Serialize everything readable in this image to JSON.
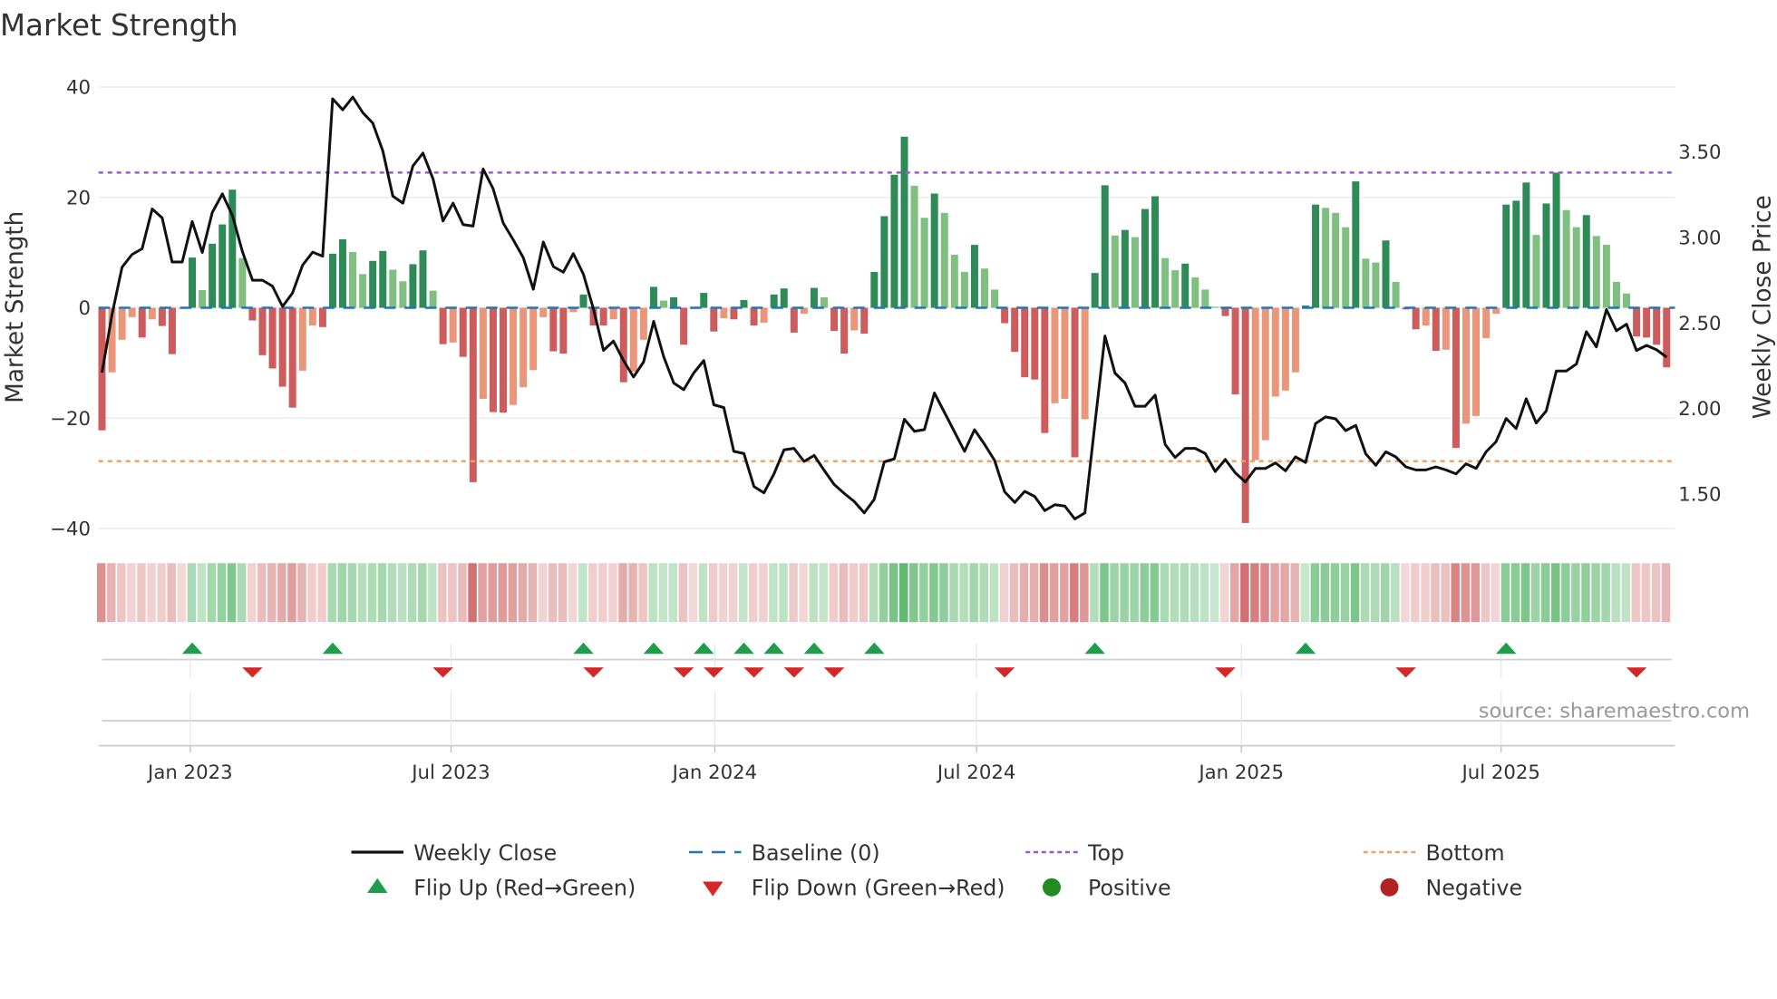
{
  "title": "Market Strength",
  "chart_data": {
    "type": "bar",
    "title": "Market Strength",
    "ylabel": "Market Strength",
    "y2label": "Weekly Close Price",
    "ylim": [
      -42,
      42
    ],
    "y2lim": [
      1.3,
      3.876
    ],
    "yticks": [
      "40",
      "20",
      "0",
      "−20",
      "−40"
    ],
    "ytick_values": [
      40,
      20,
      0,
      -20,
      -40
    ],
    "y2ticks": [
      "3.50",
      "3.00",
      "2.50",
      "2.00",
      "1.50"
    ],
    "y2tick_values": [
      3.5,
      3.0,
      2.5,
      2.0,
      1.5
    ],
    "xticks": [
      {
        "label": "Jan 2023",
        "week": 8.8
      },
      {
        "label": "Jul 2023",
        "week": 34.8
      },
      {
        "label": "Jan 2024",
        "week": 61.1
      },
      {
        "label": "Jul 2024",
        "week": 87.2
      },
      {
        "label": "Jan 2025",
        "week": 113.6
      },
      {
        "label": "Jul 2025",
        "week": 139.5
      }
    ],
    "top_level": 24.5,
    "bottom_level": -27.8,
    "baseline": 0,
    "strength": [
      -22.2,
      -11.7,
      -5.8,
      -1.7,
      -5.4,
      -2.1,
      -3.3,
      -8.4,
      -0.2,
      9.1,
      3.2,
      11.6,
      15.1,
      21.4,
      9.0,
      -2.3,
      -8.6,
      -11.0,
      -14.3,
      -18.1,
      -11.4,
      -3.2,
      -3.5,
      9.8,
      12.4,
      10.1,
      6.1,
      8.5,
      10.3,
      6.9,
      4.8,
      7.9,
      10.4,
      3.1,
      -6.6,
      -6.3,
      -8.9,
      -31.6,
      -16.5,
      -18.9,
      -19.0,
      -17.6,
      -14.4,
      -11.3,
      -1.7,
      -7.9,
      -8.3,
      -0.8,
      2.4,
      -3.2,
      -3.2,
      -2.1,
      -13.5,
      -11.6,
      -5.8,
      3.8,
      1.3,
      1.9,
      -6.7,
      -0.2,
      2.7,
      -4.3,
      -1.9,
      -2.1,
      1.4,
      -3.2,
      -2.7,
      2.4,
      3.5,
      -4.5,
      -1.1,
      3.6,
      1.9,
      -4.2,
      -8.3,
      -4.1,
      -4.7,
      6.5,
      16.6,
      24.1,
      31.0,
      22.1,
      16.3,
      20.7,
      17.2,
      9.6,
      6.5,
      11.4,
      7.1,
      3.3,
      -2.8,
      -8.0,
      -12.6,
      -13.0,
      -22.7,
      -17.3,
      -16.5,
      -27.1,
      -20.2,
      6.3,
      22.2,
      13.1,
      14.1,
      12.8,
      17.9,
      20.2,
      9.0,
      6.8,
      8.0,
      5.5,
      3.3,
      0.2,
      -1.5,
      -15.7,
      -39.0,
      -27.6,
      -24.0,
      -16.1,
      -15.0,
      -11.7,
      0.4,
      18.7,
      18.1,
      17.2,
      14.6,
      22.9,
      8.9,
      8.2,
      12.2,
      4.7,
      -0.3,
      -3.9,
      -3.2,
      -7.8,
      -7.6,
      -25.4,
      -21.0,
      -19.6,
      -5.5,
      -1.1,
      18.7,
      19.4,
      22.7,
      13.2,
      18.9,
      24.5,
      17.7,
      14.6,
      16.8,
      13.0,
      11.4,
      4.7,
      2.6,
      -5.2,
      -5.4,
      -6.7,
      -10.8
    ],
    "weekly_close": [
      2.21,
      2.548,
      2.826,
      2.9,
      2.934,
      3.166,
      3.114,
      2.856,
      2.856,
      3.093,
      2.912,
      3.146,
      3.254,
      3.128,
      2.917,
      2.75,
      2.75,
      2.715,
      2.596,
      2.675,
      2.838,
      2.914,
      2.89,
      3.81,
      3.746,
      3.82,
      3.729,
      3.668,
      3.505,
      3.242,
      3.2,
      3.417,
      3.493,
      3.342,
      3.096,
      3.2,
      3.075,
      3.066,
      3.4,
      3.285,
      3.084,
      2.987,
      2.882,
      2.697,
      2.973,
      2.829,
      2.797,
      2.905,
      2.785,
      2.583,
      2.34,
      2.394,
      2.28,
      2.184,
      2.272,
      2.509,
      2.303,
      2.149,
      2.11,
      2.207,
      2.28,
      2.022,
      2.005,
      1.75,
      1.737,
      1.544,
      1.507,
      1.617,
      1.758,
      1.767,
      1.691,
      1.726,
      1.639,
      1.556,
      1.504,
      1.456,
      1.39,
      1.469,
      1.688,
      1.705,
      1.937,
      1.867,
      1.877,
      2.091,
      1.977,
      1.863,
      1.75,
      1.876,
      1.79,
      1.697,
      1.513,
      1.451,
      1.516,
      1.486,
      1.403,
      1.438,
      1.43,
      1.354,
      1.39,
      1.908,
      2.424,
      2.207,
      2.149,
      2.013,
      2.013,
      2.078,
      1.79,
      1.714,
      1.767,
      1.767,
      1.737,
      1.632,
      1.702,
      1.624,
      1.571,
      1.65,
      1.65,
      1.682,
      1.636,
      1.717,
      1.685,
      1.912,
      1.951,
      1.94,
      1.871,
      1.901,
      1.735,
      1.668,
      1.747,
      1.717,
      1.659,
      1.641,
      1.641,
      1.659,
      1.641,
      1.618,
      1.677,
      1.65,
      1.747,
      1.806,
      1.942,
      1.883,
      2.057,
      1.915,
      1.986,
      2.219,
      2.219,
      2.26,
      2.449,
      2.36,
      2.578,
      2.454,
      2.493,
      2.339,
      2.369,
      2.343,
      2.3
    ],
    "flip_up_weeks": [
      9,
      23,
      48,
      55,
      60,
      64,
      67,
      71,
      77,
      99,
      120,
      140
    ],
    "flip_down_weeks": [
      15,
      34,
      49,
      58,
      61,
      65,
      69,
      73,
      90,
      112,
      130,
      153
    ],
    "legend": [
      {
        "label": "Weekly Close",
        "kind": "line-solid",
        "color": "#111111"
      },
      {
        "label": "Baseline (0)",
        "kind": "line-dashed",
        "color": "#1f77b4"
      },
      {
        "label": "Top",
        "kind": "line-dotted",
        "color": "#9b59d0"
      },
      {
        "label": "Bottom",
        "kind": "line-dotted",
        "color": "#f0a060"
      },
      {
        "label": "Flip Up (Red→Green)",
        "kind": "tri-up",
        "color": "#1e9e4a"
      },
      {
        "label": "Flip Down (Green→Red)",
        "kind": "tri-down",
        "color": "#d62728"
      },
      {
        "label": "Positive",
        "kind": "dot",
        "color": "#228b22"
      },
      {
        "label": "Negative",
        "kind": "dot",
        "color": "#b22222"
      }
    ],
    "legend_placement": "bottom-center",
    "colors": {
      "pos_rising": "#2e8b57",
      "pos_falling": "#7fbf7f",
      "neg_falling": "#cd5c5c",
      "neg_rising": "#e9967a",
      "line": "#111111",
      "top": "#9b59d0",
      "bottom": "#f0a060",
      "baseline": "#1f77b4"
    }
  },
  "source_note": "source: sharemaestro.com"
}
